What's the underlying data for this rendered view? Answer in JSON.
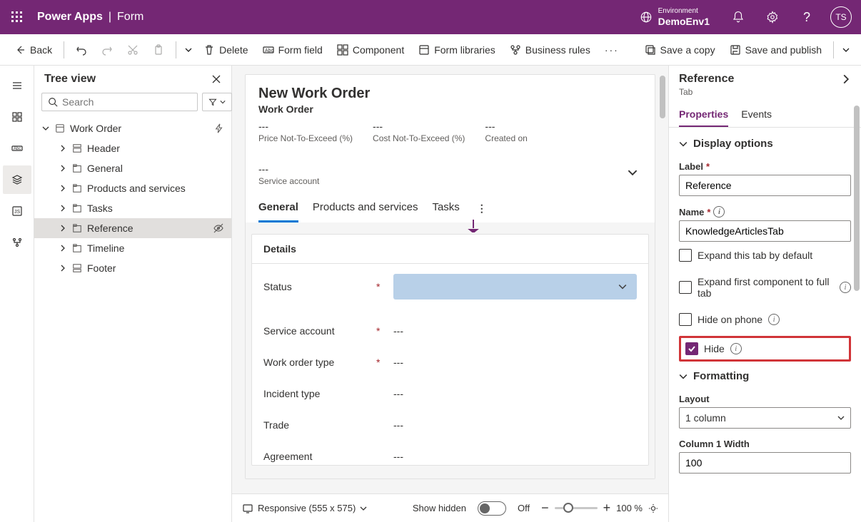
{
  "header": {
    "app": "Power Apps",
    "page": "Form",
    "env_label": "Environment",
    "env_name": "DemoEnv1",
    "avatar": "TS"
  },
  "commands": {
    "back": "Back",
    "delete": "Delete",
    "form_field": "Form field",
    "component": "Component",
    "form_libraries": "Form libraries",
    "business_rules": "Business rules",
    "save_copy": "Save a copy",
    "save_publish": "Save and publish"
  },
  "tree": {
    "title": "Tree view",
    "search_placeholder": "Search",
    "root": "Work Order",
    "nodes": {
      "header": "Header",
      "general": "General",
      "products": "Products and services",
      "tasks": "Tasks",
      "reference": "Reference",
      "timeline": "Timeline",
      "footer": "Footer"
    }
  },
  "form": {
    "title": "New Work Order",
    "entity": "Work Order",
    "header_fields": [
      {
        "value": "---",
        "label": "Price Not-To-Exceed (%)"
      },
      {
        "value": "---",
        "label": "Cost Not-To-Exceed (%)"
      },
      {
        "value": "---",
        "label": "Created on"
      },
      {
        "value": "---",
        "label": "Service account"
      }
    ],
    "tabs": {
      "general": "General",
      "products": "Products and services",
      "tasks": "Tasks"
    },
    "section": {
      "title": "Details",
      "fields": [
        {
          "label": "Status",
          "req": true,
          "type": "dropdown",
          "value": ""
        },
        {
          "label": "Service account",
          "req": true,
          "value": "---"
        },
        {
          "label": "Work order type",
          "req": true,
          "value": "---"
        },
        {
          "label": "Incident type",
          "req": false,
          "value": "---"
        },
        {
          "label": "Trade",
          "req": false,
          "value": "---"
        },
        {
          "label": "Agreement",
          "req": false,
          "value": "---"
        }
      ]
    }
  },
  "status": {
    "responsive": "Responsive (555 x 575)",
    "show_hidden": "Show hidden",
    "toggle": "Off",
    "zoom": "100 %"
  },
  "props": {
    "title": "Reference",
    "type": "Tab",
    "tabs": {
      "properties": "Properties",
      "events": "Events"
    },
    "display": "Display options",
    "label_lbl": "Label",
    "label_val": "Reference",
    "name_lbl": "Name",
    "name_val": "KnowledgeArticlesTab",
    "expand_default": "Expand this tab by default",
    "expand_full": "Expand first component to full tab",
    "hide_phone": "Hide on phone",
    "hide": "Hide",
    "formatting": "Formatting",
    "layout_lbl": "Layout",
    "layout_val": "1 column",
    "col1_lbl": "Column 1 Width",
    "col1_val": "100"
  }
}
